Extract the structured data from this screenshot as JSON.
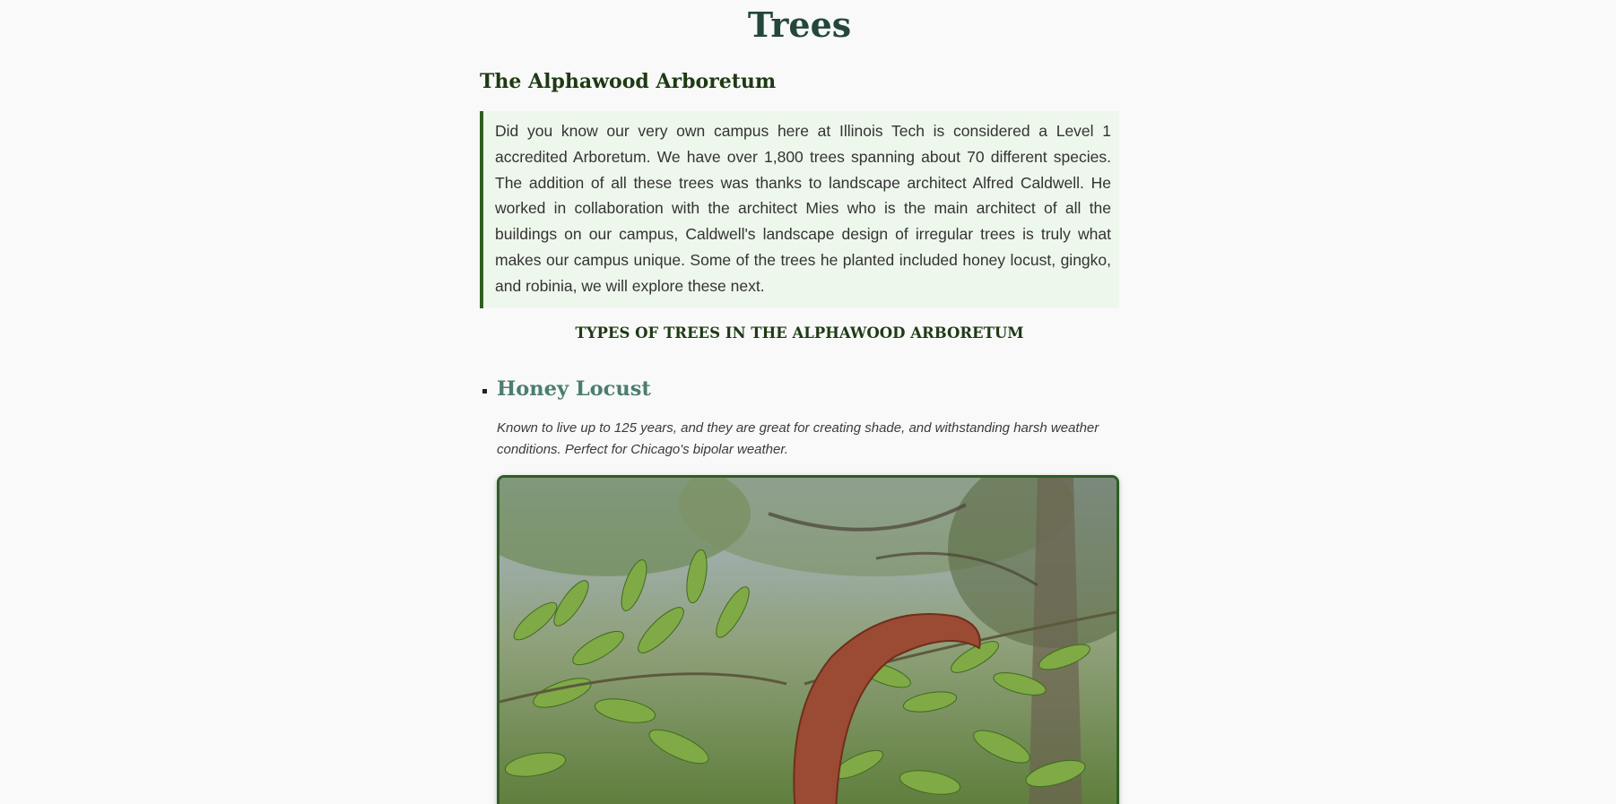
{
  "page": {
    "title": "Trees"
  },
  "arboretum": {
    "heading": "The Alphawood Arboretum",
    "intro": "Did you know our very own campus here at Illinois Tech is considered a Level 1 accredited Arboretum. We have over 1,800 trees spanning about 70 different species. The addition of all these trees was thanks to landscape architect Alfred Caldwell. He worked in collaboration with the architect Mies who is the main architect of all the buildings on our campus, Caldwell's landscape design of irregular trees is truly what makes our campus unique. Some of the trees he planted included honey locust, gingko, and robinia, we will explore these next."
  },
  "types": {
    "heading": "TYPES OF TREES IN THE ALPHAWOOD ARBORETUM",
    "items": [
      {
        "name": "Honey Locust",
        "description": "Known to live up to 125 years, and they are great for creating shade, and withstanding harsh weather conditions. Perfect for Chicago's bipolar weather.",
        "image_icon": "honey-locust-photo"
      }
    ]
  },
  "colors": {
    "title": "#24463d",
    "heading": "#1e3a14",
    "tree_name": "#4b7d71",
    "accent_border": "#2f5e23",
    "intro_bg": "#eef7ec",
    "page_bg": "#f8f9f8"
  }
}
